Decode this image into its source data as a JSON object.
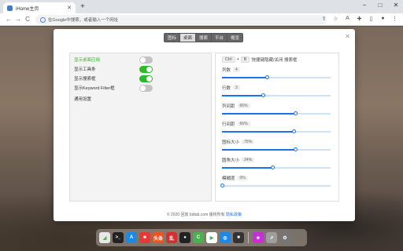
{
  "browser": {
    "tab_title": "iHome主页",
    "tab_close": "✕",
    "new_tab": "+",
    "address_placeholder": "在Google中搜索，或者输入一个网址",
    "nav": {
      "back": "←",
      "forward": "→",
      "reload": "C"
    },
    "window": {
      "minimize": "−",
      "maximize": "□",
      "close": "✕"
    },
    "toolbar_icons": [
      "share-icon",
      "star-icon",
      "translate-icon",
      "extension-icon",
      "sidebar-icon",
      "profile-icon",
      "menu-icon"
    ]
  },
  "modal": {
    "tabs": [
      "图标",
      "桌面",
      "搜索",
      "平台",
      "概览"
    ],
    "active_tab": 1,
    "close": "✕",
    "options": [
      {
        "label": "显示桌面应用",
        "on": false,
        "highlight": true
      },
      {
        "label": "显示工具条",
        "on": true,
        "highlight": false
      },
      {
        "label": "显示搜索框",
        "on": true,
        "highlight": false
      },
      {
        "label": "显示Keyword Filter框",
        "on": false,
        "highlight": false
      },
      {
        "label": "通用设置",
        "on": null,
        "highlight": false
      }
    ],
    "shortcut": {
      "key1": "Ctrl",
      "plus": "+",
      "key2": "B",
      "desc": "快捷键隐藏/关闭 搜索框"
    },
    "sliders": [
      {
        "label": "列数",
        "value": "4",
        "fraction": 0.42
      },
      {
        "label": "行数",
        "value": "3",
        "fraction": 0.38
      },
      {
        "label": "列间距",
        "value": "66%",
        "fraction": 0.68
      },
      {
        "label": "行间距",
        "value": "66%",
        "fraction": 0.66
      },
      {
        "label": "图标大小",
        "value": "75%",
        "fraction": 0.68
      },
      {
        "label": "圆角大小",
        "value": "24%",
        "fraction": 0.47
      },
      {
        "label": "模糊度",
        "value": "0%",
        "fraction": 0.0
      }
    ],
    "footer": {
      "text": "© 2020 回放 bdtab.com 版权所有",
      "link": "隐私政策"
    }
  },
  "dock": {
    "items": [
      {
        "name": "launchpad-icon",
        "color": "#e8e8e8",
        "glyph": "◢"
      },
      {
        "name": "terminal-icon",
        "color": "#222222",
        "glyph": ">_"
      },
      {
        "name": "appstore-icon",
        "color": "#1e88e5",
        "glyph": "A"
      },
      {
        "name": "weibo-icon",
        "color": "#e53935",
        "glyph": "☻"
      },
      {
        "name": "toutiao-icon",
        "color": "#f4511e",
        "glyph": "头条"
      },
      {
        "name": "red-app-icon",
        "color": "#d32f2f",
        "glyph": "乱"
      },
      {
        "name": "github-icon",
        "color": "#222222",
        "glyph": "●"
      },
      {
        "name": "c-app-icon",
        "color": "#4caf50",
        "glyph": "C"
      },
      {
        "name": "play-store-icon",
        "color": "#ffffff",
        "glyph": "▶"
      },
      {
        "name": "chrome-icon",
        "color": "#1e88e5",
        "glyph": "◎"
      },
      {
        "name": "record-icon",
        "color": "#333333",
        "glyph": "■"
      }
    ],
    "after_sep": [
      {
        "name": "star-app-icon",
        "color": "#c52fd6",
        "glyph": "★"
      },
      {
        "name": "rocket-icon",
        "color": "#9e9e9e",
        "glyph": "➚"
      },
      {
        "name": "settings-icon",
        "color": "#757575",
        "glyph": "⚙"
      }
    ]
  }
}
